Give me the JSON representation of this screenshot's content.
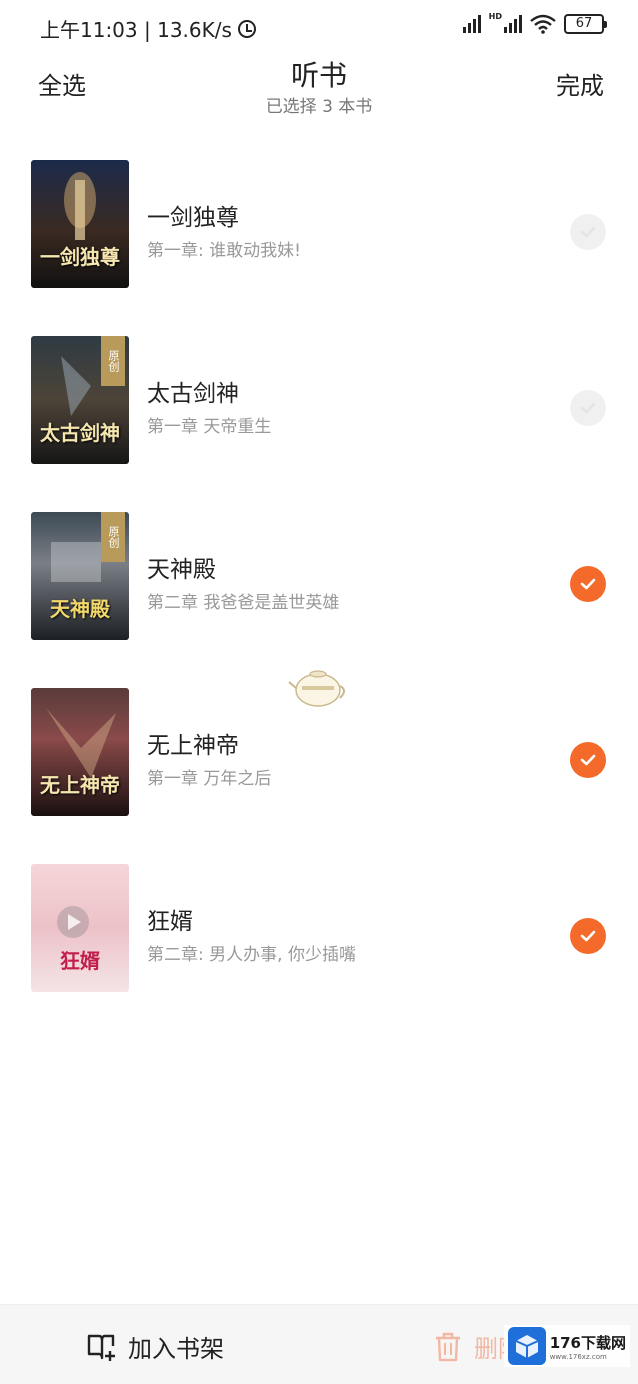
{
  "status_bar": {
    "time_speed": "上午11:03 | 13.6K/s",
    "battery": "67",
    "hd_label": "HD"
  },
  "header": {
    "select_all": "全选",
    "title": "听书",
    "subtitle": "已选择 3 本书",
    "done": "完成"
  },
  "books": [
    {
      "title": "一剑独尊",
      "chapter": "第一章: 谁敢动我妹!",
      "selected": false,
      "cover_text": "一剑独尊",
      "cover_badge": ""
    },
    {
      "title": "太古剑神",
      "chapter": "第一章 天帝重生",
      "selected": false,
      "cover_text": "太古剑神",
      "cover_badge": "原创"
    },
    {
      "title": "天神殿",
      "chapter": "第二章 我爸爸是盖世英雄",
      "selected": true,
      "cover_text": "天神殿",
      "cover_badge": "原创"
    },
    {
      "title": "无上神帝",
      "chapter": "第一章 万年之后",
      "selected": true,
      "cover_text": "无上神帝",
      "cover_badge": ""
    },
    {
      "title": "狂婿",
      "chapter": "第二章: 男人办事, 你少插嘴",
      "selected": true,
      "cover_text": "狂婿",
      "cover_badge": ""
    }
  ],
  "bottom_bar": {
    "add_to_shelf": "加入书架",
    "delete": "删除"
  },
  "watermark": {
    "main": "176下载网",
    "sub": "www.176xz.com"
  },
  "colors": {
    "accent": "#f36a2a",
    "unchecked": "#f0f0f0",
    "delete_text": "#f2b8a4"
  }
}
